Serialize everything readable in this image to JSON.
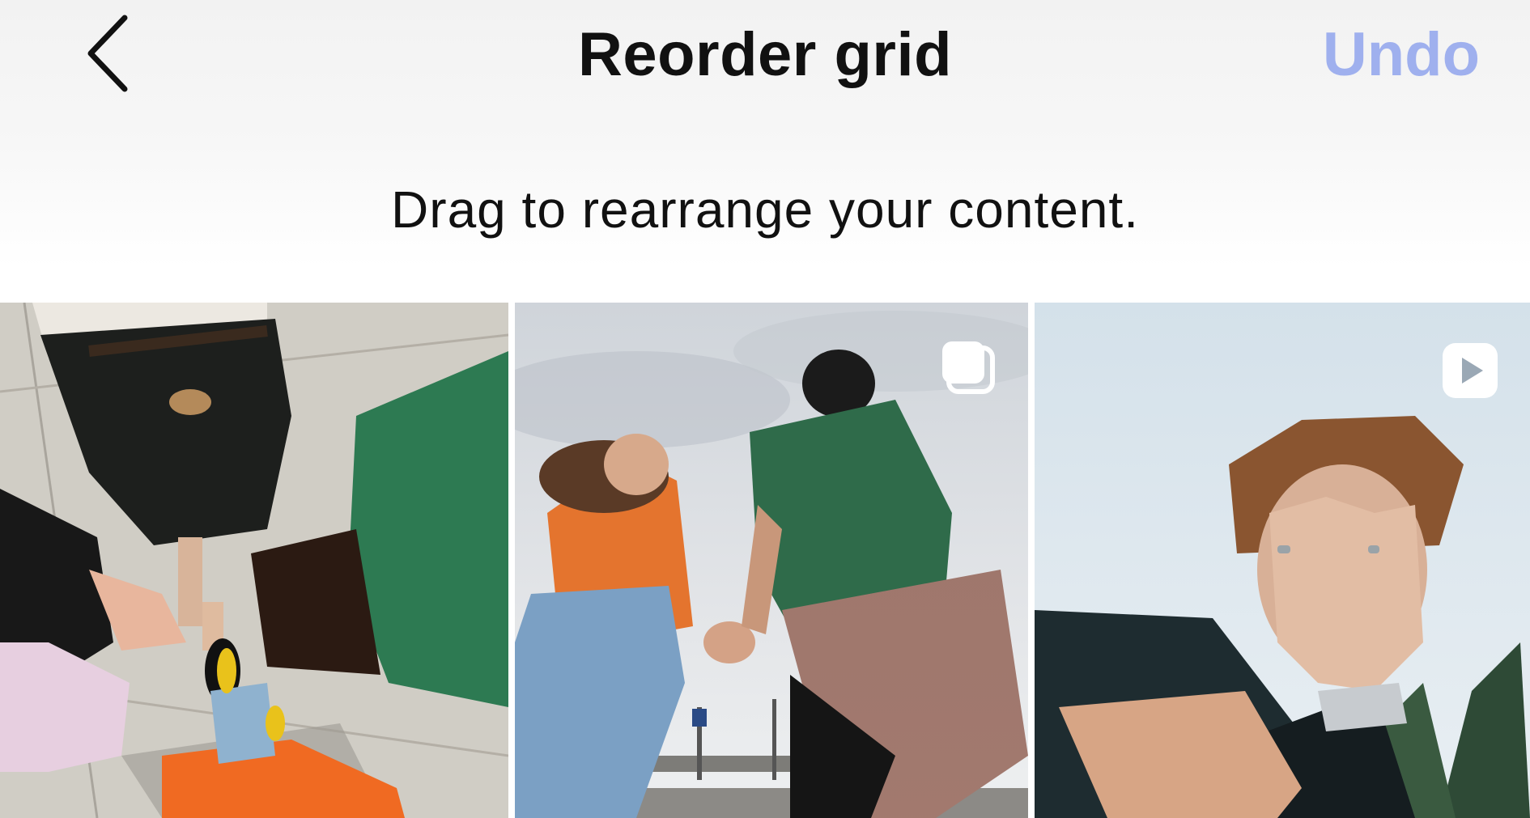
{
  "header": {
    "back_icon": "chevron-left-icon",
    "title": "Reorder grid",
    "undo_label": "Undo",
    "undo_color": "#9fb0ee"
  },
  "instruction": "Drag to rearrange your content.",
  "grid": {
    "tiles": [
      {
        "type": "photo",
        "badge_icon": null,
        "description": "feet-circle-overhead"
      },
      {
        "type": "carousel",
        "badge_icon": "carousel-icon",
        "description": "couple-holding-hands"
      },
      {
        "type": "reel",
        "badge_icon": "reel-play-icon",
        "description": "face-in-hands"
      }
    ]
  }
}
